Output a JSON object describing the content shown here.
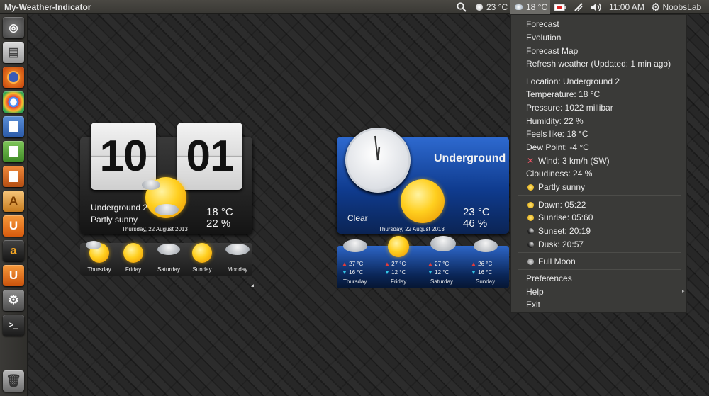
{
  "panel": {
    "app_title": "My-Weather-Indicator",
    "temp_location1": "23 °C",
    "temp_location2": "18 °C",
    "time": "11:00 AM",
    "user": "NoobsLab"
  },
  "launcher": {
    "items": [
      "dash-home",
      "file-cabinet",
      "firefox",
      "chrome",
      "writer",
      "calc",
      "impress",
      "software-center",
      "ubuntu-one",
      "amazon",
      "ubuntu-one-music",
      "system-settings",
      "terminal",
      "trash"
    ]
  },
  "menu": {
    "forecast": "Forecast",
    "evolution": "Evolution",
    "forecast_map": "Forecast Map",
    "refresh": "Refresh weather (Updated: 1 min ago)",
    "location": "Location: Underground 2",
    "temperature": "Temperature: 18 °C",
    "pressure": "Pressure: 1022 millibar",
    "humidity": "Humidity: 22 %",
    "feels_like": "Feels like: 18 °C",
    "dew_point": "Dew Point: -4 °C",
    "wind": "Wind: 3 km/h (SW)",
    "cloudiness": "Cloudiness: 24 %",
    "condition": "Partly sunny",
    "dawn": "Dawn: 05:22",
    "sunrise": "Sunrise: 05:60",
    "sunset": "Sunset: 20:19",
    "dusk": "Dusk: 20:57",
    "moon": "Full Moon",
    "preferences": "Preferences",
    "help": "Help",
    "exit": "Exit"
  },
  "clock_widget": {
    "hours": "10",
    "minutes": "01",
    "location": "Underground 2",
    "condition": "Partly sunny",
    "temp": "18 °C",
    "humidity": "22 %",
    "date": "Thursday, 22 August 2013",
    "days": [
      "Thursday",
      "Friday",
      "Saturday",
      "Sunday",
      "Monday"
    ]
  },
  "ug_widget": {
    "title": "Underground",
    "condition": "Clear",
    "temp": "23 °C",
    "humidity": "46 %",
    "date": "Thursday, 22 August 2013",
    "forecast": [
      {
        "day": "Thursday",
        "high": "27 °C",
        "low": "16 °C"
      },
      {
        "day": "Friday",
        "high": "27 °C",
        "low": "12 °C"
      },
      {
        "day": "Saturday",
        "high": "27 °C",
        "low": "12 °C"
      },
      {
        "day": "Sunday",
        "high": "26 °C",
        "low": "16 °C"
      }
    ]
  },
  "colors": {
    "panel_bg": "#3f3e3a",
    "menu_bg": "#3a3a38",
    "ug_blue": "#1d4fa8",
    "high_arrow": "#e23b3b",
    "low_arrow": "#33c6e6"
  }
}
